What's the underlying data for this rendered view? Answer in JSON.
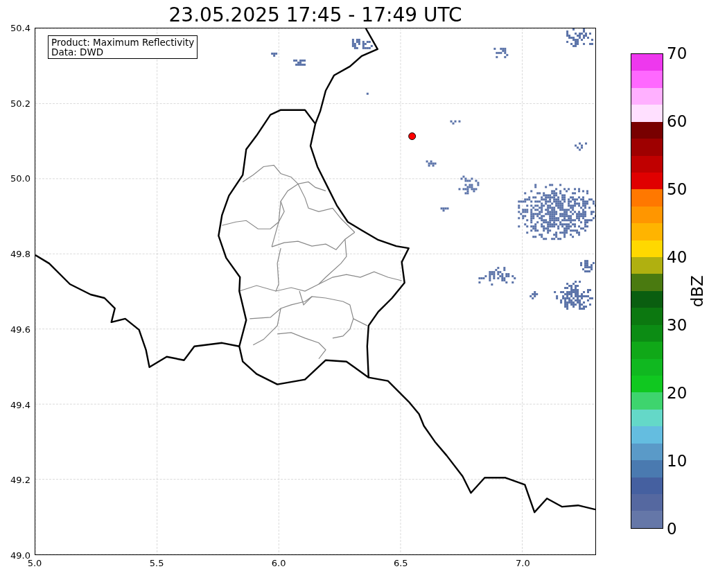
{
  "title": "23.05.2025 17:45 - 17:49 UTC",
  "info_box": {
    "lines": [
      "Product: Maximum Reflectivity",
      "Data: DWD"
    ]
  },
  "map": {
    "x_ticks": [
      "5.0",
      "5.5",
      "6.0",
      "6.5",
      "7.0"
    ],
    "y_ticks": [
      "50.4",
      "50.2",
      "50.0",
      "49.8",
      "49.6",
      "49.4",
      "49.2",
      "49.0"
    ]
  },
  "colorbar": {
    "label": "dBZ",
    "ticks": [
      "70",
      "60",
      "50",
      "40",
      "30",
      "20",
      "10",
      "0"
    ],
    "bins": [
      {
        "color": "#6577a8"
      },
      {
        "color": "#5568a0"
      },
      {
        "color": "#4560a0"
      },
      {
        "color": "#4a7ab0"
      },
      {
        "color": "#5a9ac8"
      },
      {
        "color": "#64bde0"
      },
      {
        "color": "#64d8c8"
      },
      {
        "color": "#3ed46e"
      },
      {
        "color": "#10c820"
      },
      {
        "color": "#10b820"
      },
      {
        "color": "#10a818"
      },
      {
        "color": "#0c8c14"
      },
      {
        "color": "#0c7810"
      },
      {
        "color": "#0a5e10"
      },
      {
        "color": "#4a7a10"
      },
      {
        "color": "#b0b010"
      },
      {
        "color": "#ffd800"
      },
      {
        "color": "#ffb400"
      },
      {
        "color": "#ff9600"
      },
      {
        "color": "#ff7800"
      },
      {
        "color": "#e00000"
      },
      {
        "color": "#c00000"
      },
      {
        "color": "#9e0000"
      },
      {
        "color": "#780000"
      },
      {
        "color": "#ffe0ff"
      },
      {
        "color": "#ffb0ff"
      },
      {
        "color": "#ff68ff"
      },
      {
        "color": "#ee38ee"
      }
    ]
  }
}
